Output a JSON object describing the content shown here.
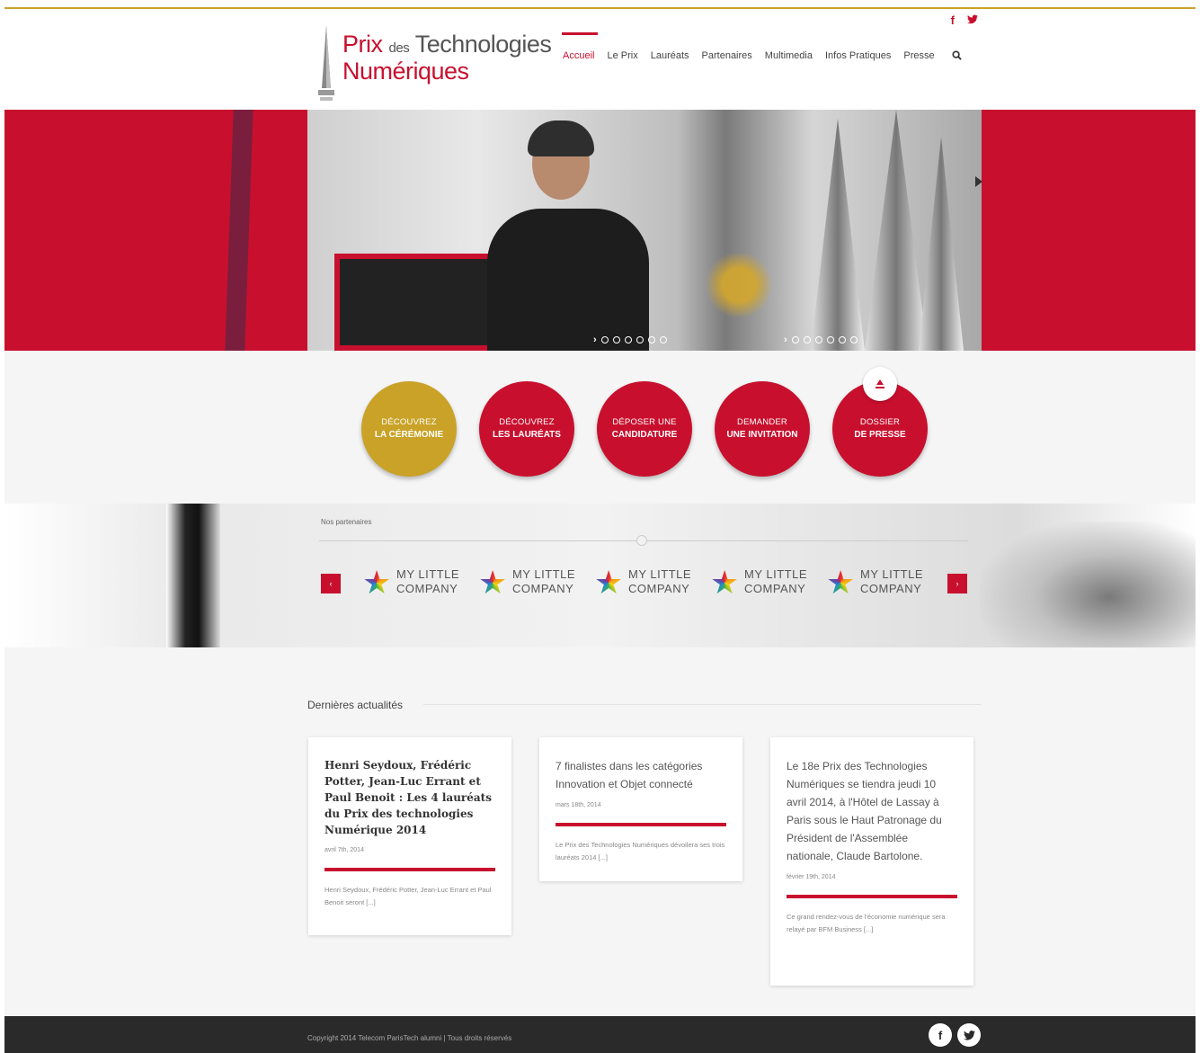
{
  "header": {
    "logo": {
      "line1_prefix": "Prix",
      "line1_small": "des",
      "line1_suffix": "Technologies",
      "line2": "Numériques"
    },
    "social": {
      "facebook": "f",
      "twitter": "t"
    },
    "nav": [
      "Accueil",
      "Le Prix",
      "Lauréats",
      "Partenaires",
      "Multimedia",
      "Infos Pratiques",
      "Presse"
    ],
    "search_icon": "search-icon"
  },
  "hero": {
    "slider_dots_count": 6,
    "arrow": "›"
  },
  "circles": [
    {
      "line1": "DÉCOUVREZ",
      "line2": "LA CÉRÉMONIE",
      "color": "#c9a227"
    },
    {
      "line1": "DÉCOUVREZ",
      "line2": "LES LAURÉATS",
      "color": "#c8102e"
    },
    {
      "line1": "DÉPOSER UNE",
      "line2": "CANDIDATURE",
      "color": "#c8102e"
    },
    {
      "line1": "DEMANDER",
      "line2": "UNE INVITATION",
      "color": "#c8102e"
    },
    {
      "line1": "DOSSIER",
      "line2": "DE PRESSE",
      "color": "#c8102e"
    }
  ],
  "partners": {
    "heading": "Nos partenaires",
    "prev": "‹",
    "next": "›",
    "logos": [
      {
        "line1": "MY LITTLE",
        "line2": "COMPANY"
      },
      {
        "line1": "MY LITTLE",
        "line2": "COMPANY"
      },
      {
        "line1": "MY LITTLE",
        "line2": "COMPANY"
      },
      {
        "line1": "MY LITTLE",
        "line2": "COMPANY"
      },
      {
        "line1": "MY LITTLE",
        "line2": "COMPANY"
      }
    ]
  },
  "news": {
    "title": "Dernières actualités",
    "cards": [
      {
        "title": "Henri Seydoux, Frédéric Potter, Jean-Luc Errant et Paul Benoit : Les 4 lauréats du Prix des technologies Numérique 2014",
        "date": "avril 7th, 2014",
        "excerpt": "Henri Seydoux, Frédéric Potter, Jean-Luc Errant et Paul Benoit seront [...]"
      },
      {
        "title": "7 finalistes dans les catégories Innovation et Objet connecté",
        "date": "mars 18th, 2014",
        "excerpt": "Le Prix des Technologies Numériques dévoilera ses trois lauréats 2014 [...]"
      },
      {
        "title": "Le 18e Prix des Technologies Numériques se tiendra jeudi 10 avril 2014, à l'Hôtel de Lassay à Paris sous le Haut Patronage du Président de l'Assemblée nationale, Claude Bartolone.",
        "date": "février 19th, 2014",
        "excerpt": "Ce grand rendez-vous de l'économie numérique sera relayé par BFM Business [...]"
      }
    ]
  },
  "footer": {
    "copyright": "Copyright 2014 Telecom ParisTech alumni | Tous droits réservés",
    "facebook": "f",
    "twitter": "t"
  }
}
